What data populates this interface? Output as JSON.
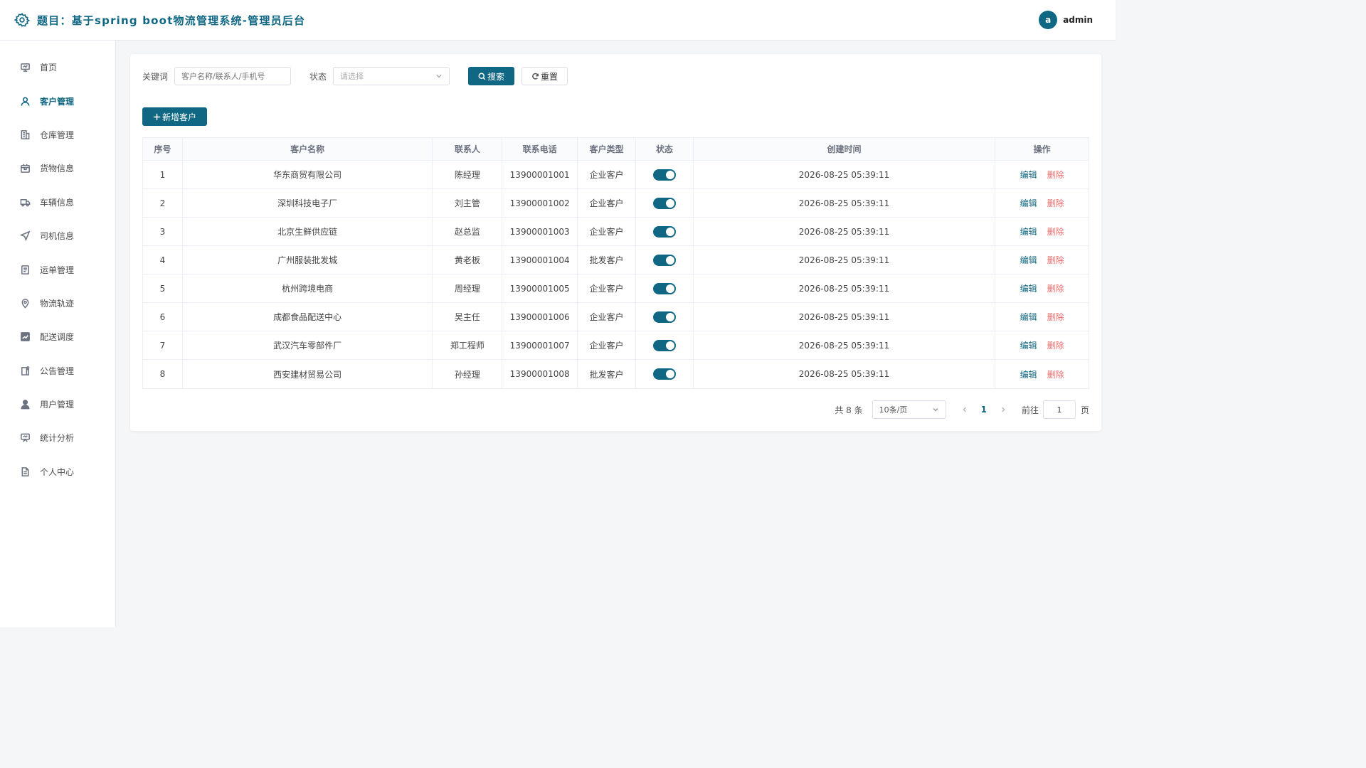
{
  "header": {
    "title": "题目：基于spring boot物流管理系统-管理员后台",
    "avatar_letter": "a",
    "username": "admin",
    "accent_color": "#0f6784"
  },
  "sidebar": {
    "items": [
      {
        "label": "首页",
        "icon": "dashboard-icon",
        "active": false
      },
      {
        "label": "客户管理",
        "icon": "user-icon",
        "active": true
      },
      {
        "label": "仓库管理",
        "icon": "building-icon",
        "active": false
      },
      {
        "label": "货物信息",
        "icon": "box-icon",
        "active": false
      },
      {
        "label": "车辆信息",
        "icon": "truck-icon",
        "active": false
      },
      {
        "label": "司机信息",
        "icon": "navigation-icon",
        "active": false
      },
      {
        "label": "运单管理",
        "icon": "document-icon",
        "active": false
      },
      {
        "label": "物流轨迹",
        "icon": "location-pin-icon",
        "active": false
      },
      {
        "label": "配送调度",
        "icon": "chart-icon",
        "active": false
      },
      {
        "label": "公告管理",
        "icon": "notice-icon",
        "active": false
      },
      {
        "label": "用户管理",
        "icon": "person-icon",
        "active": false
      },
      {
        "label": "统计分析",
        "icon": "presentation-icon",
        "active": false
      },
      {
        "label": "个人中心",
        "icon": "file-icon",
        "active": false
      }
    ]
  },
  "search": {
    "keyword_label": "关键词",
    "keyword_placeholder": "客户名称/联系人/手机号",
    "status_label": "状态",
    "status_placeholder": "请选择",
    "search_button": "搜索",
    "reset_button": "重置"
  },
  "toolbar": {
    "add_button": "新增客户"
  },
  "table": {
    "headers": [
      "序号",
      "客户名称",
      "联系人",
      "联系电话",
      "客户类型",
      "状态",
      "创建时间",
      "操作"
    ],
    "edit_label": "编辑",
    "delete_label": "删除",
    "rows": [
      {
        "index": "1",
        "name": "华东商贸有限公司",
        "contact": "陈经理",
        "phone": "13900001001",
        "type": "企业客户",
        "enabled": true,
        "created": "2026-08-25 05:39:11"
      },
      {
        "index": "2",
        "name": "深圳科技电子厂",
        "contact": "刘主管",
        "phone": "13900001002",
        "type": "企业客户",
        "enabled": true,
        "created": "2026-08-25 05:39:11"
      },
      {
        "index": "3",
        "name": "北京生鲜供应链",
        "contact": "赵总监",
        "phone": "13900001003",
        "type": "企业客户",
        "enabled": true,
        "created": "2026-08-25 05:39:11"
      },
      {
        "index": "4",
        "name": "广州服装批发城",
        "contact": "黄老板",
        "phone": "13900001004",
        "type": "批发客户",
        "enabled": true,
        "created": "2026-08-25 05:39:11"
      },
      {
        "index": "5",
        "name": "杭州跨境电商",
        "contact": "周经理",
        "phone": "13900001005",
        "type": "企业客户",
        "enabled": true,
        "created": "2026-08-25 05:39:11"
      },
      {
        "index": "6",
        "name": "成都食品配送中心",
        "contact": "吴主任",
        "phone": "13900001006",
        "type": "企业客户",
        "enabled": true,
        "created": "2026-08-25 05:39:11"
      },
      {
        "index": "7",
        "name": "武汉汽车零部件厂",
        "contact": "郑工程师",
        "phone": "13900001007",
        "type": "企业客户",
        "enabled": true,
        "created": "2026-08-25 05:39:11"
      },
      {
        "index": "8",
        "name": "西安建材贸易公司",
        "contact": "孙经理",
        "phone": "13900001008",
        "type": "批发客户",
        "enabled": true,
        "created": "2026-08-25 05:39:11"
      }
    ]
  },
  "pagination": {
    "total_text": "共 8 条",
    "page_size": "10条/页",
    "current_page": "1",
    "goto_label": "前往",
    "goto_value": "1",
    "page_suffix": "页"
  }
}
